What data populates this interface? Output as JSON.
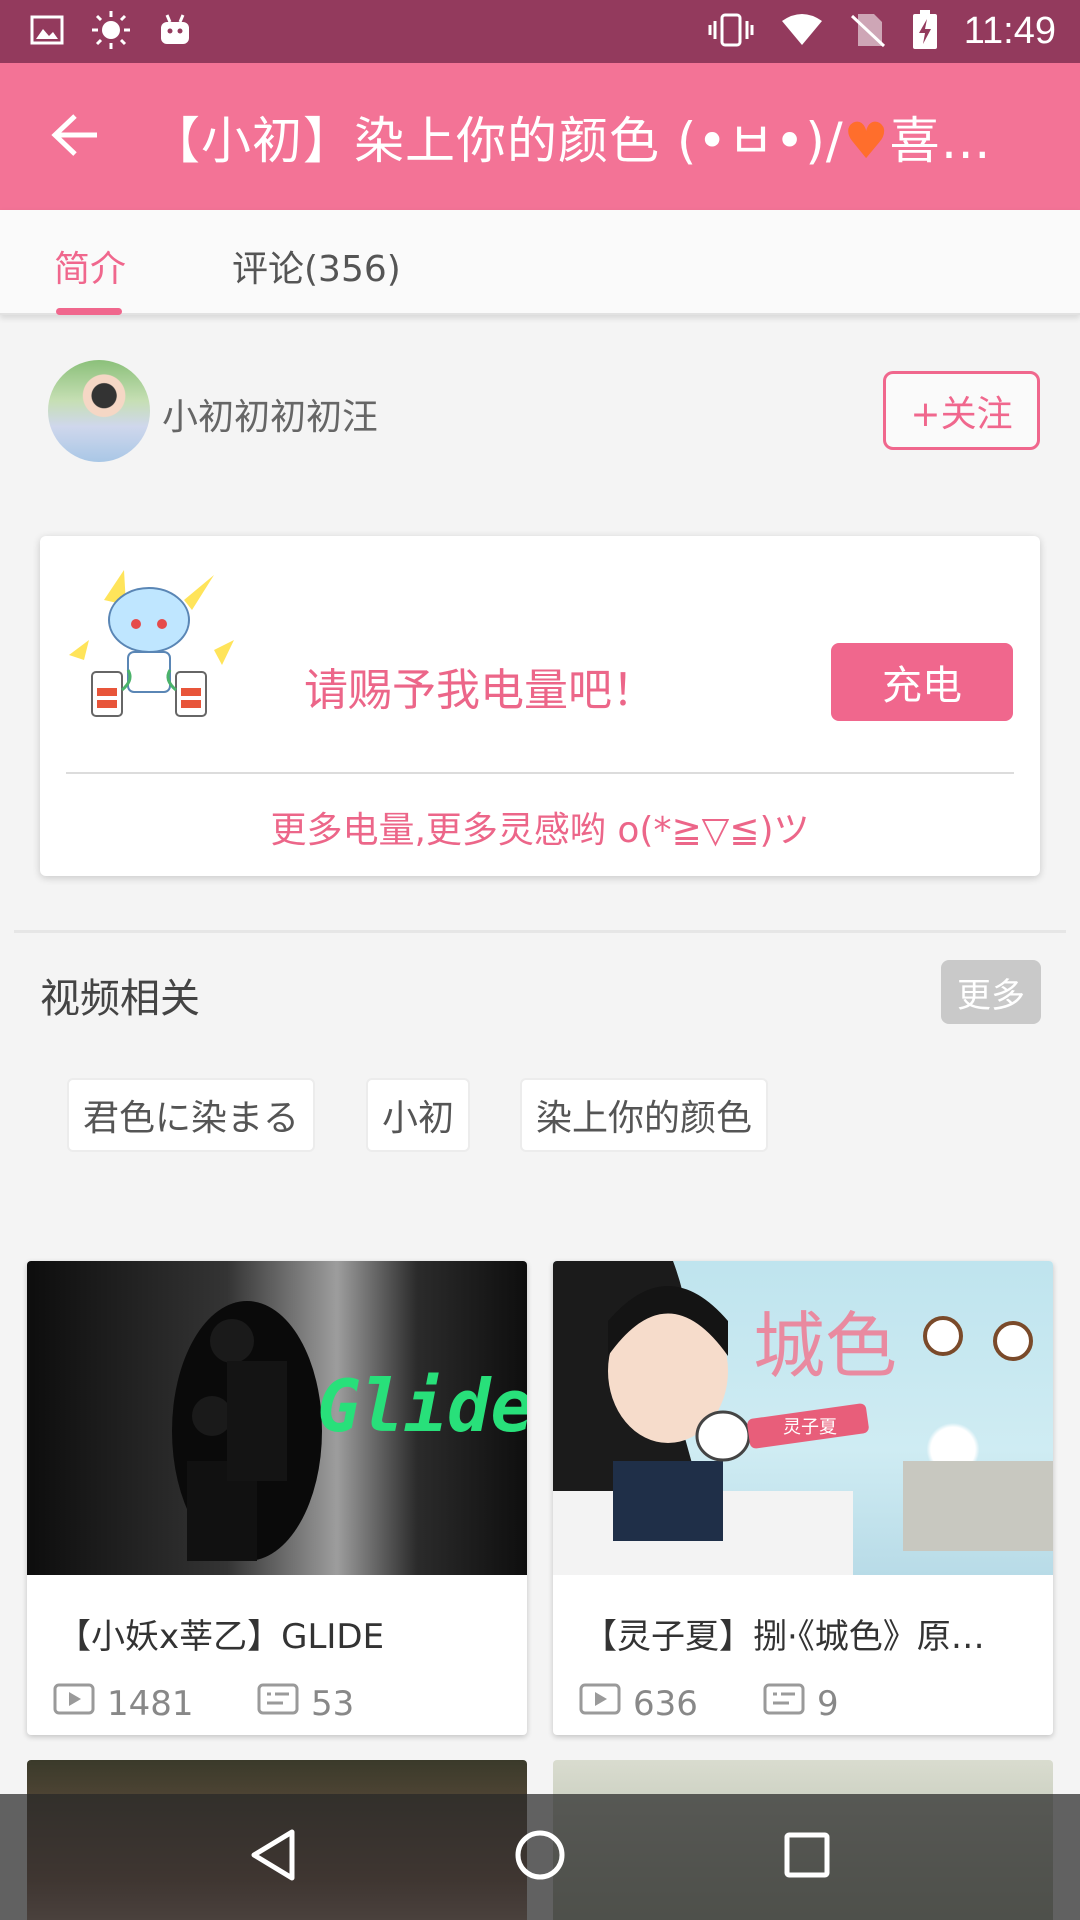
{
  "status_bar": {
    "time": "11:49"
  },
  "app_bar": {
    "title": "【小初】染上你的颜色 (•ㅂ•)/",
    "title_heart": "♥",
    "title_end": "喜欢…"
  },
  "tabs": [
    {
      "label": "简介"
    },
    {
      "label": "评论(356)"
    }
  ],
  "author": {
    "name": "小初初初初汪",
    "follow_label": "+关注"
  },
  "charge": {
    "prompt": "请赐予我电量吧！",
    "button_label": "充电",
    "subtitle": "更多电量,更多灵感哟 o(*≧▽≦)ツ"
  },
  "related": {
    "title": "视频相关",
    "more_label": "更多",
    "tags": [
      "君色に染まる",
      "小初",
      "染上你的颜色"
    ]
  },
  "videos": [
    {
      "title": "【小妖x莘乙】GLIDE",
      "plays": "1481",
      "comments": "53",
      "thumb_text": "Glide"
    },
    {
      "title": "【灵子夏】捌·《城色》原…",
      "plays": "636",
      "comments": "9",
      "thumb_text": "城色",
      "thumb_tag": "灵子夏"
    }
  ],
  "colors": {
    "accent": "#f0678d",
    "app_bar": "#f37396",
    "status_bar": "#933a5d"
  }
}
